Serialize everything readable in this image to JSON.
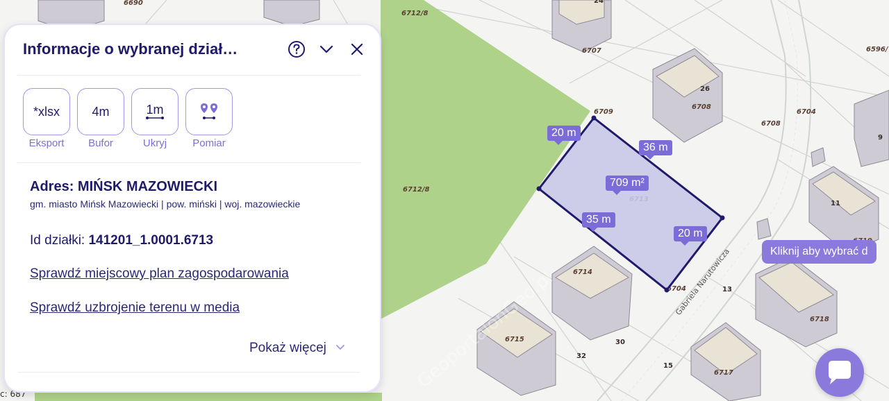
{
  "panel": {
    "title": "Informacje o wybranej dział…",
    "tools": [
      {
        "icon_text": "*xlsx",
        "label": "Eksport"
      },
      {
        "icon_text": "4m",
        "label": "Bufor"
      },
      {
        "icon_text": "1m",
        "label": "Ukryj"
      },
      {
        "icon_text": "",
        "label": "Pomiar",
        "icon": "location-pins-icon"
      }
    ],
    "address_prefix": "Adres: ",
    "address": "MIŃSK MAZOWIECKI",
    "subaddress": "gm. miasto Mińsk Mazowiecki | pow. miński | woj. mazowieckie",
    "id_label": "Id działki: ",
    "id_value": "141201_1.0001.6713",
    "link_plan": "Sprawdź miejscowy plan zagospodarowania",
    "link_media": "Sprawdź uzbrojenie terenu w media",
    "show_more": "Pokaż więcej"
  },
  "map": {
    "parcel_labels": [
      "6690",
      "6712/8",
      "6712/8",
      "6707",
      "6709",
      "6708",
      "6708",
      "6704",
      "6596/",
      "6713",
      "6714",
      "6704",
      "6715",
      "6716",
      "6718",
      "6717",
      "6719"
    ],
    "house_numbers": [
      "24",
      "26",
      "9",
      "11",
      "13",
      "30",
      "32",
      "15"
    ],
    "street": "Gabriela Narutowicza",
    "area": "709 m²",
    "edges": [
      "20 m",
      "36 m",
      "35 m",
      "20 m"
    ],
    "bottom_left_label": "c: 687",
    "watermark": "GeoportalonGeo.pl"
  },
  "tooltip": "Kliknij aby wybrać d",
  "colors": {
    "accent": "#7b6cd8",
    "parcel_fill": "#c9c8e8",
    "parcel_stroke": "#1f1b6a",
    "green_area": "#aed28a",
    "panel_border": "#e6e1fb"
  }
}
